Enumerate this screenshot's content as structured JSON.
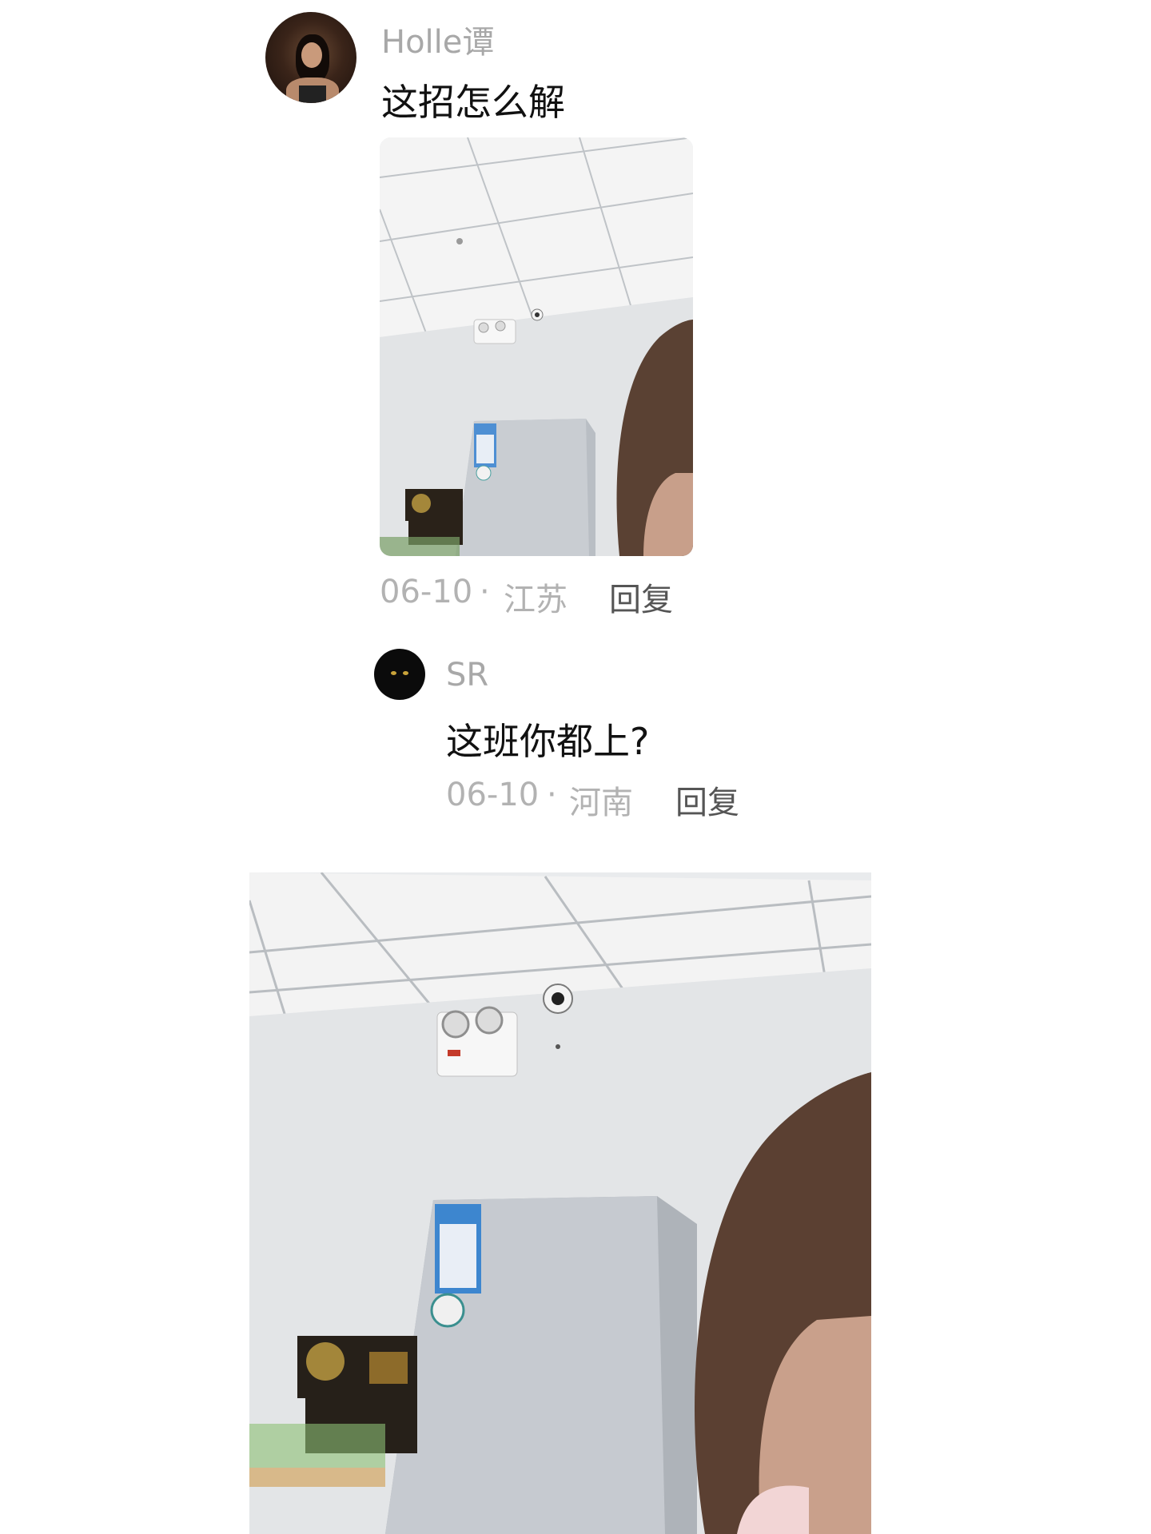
{
  "comment": {
    "username": "Holle谭",
    "text": "这招怎么解",
    "date": "06-10",
    "separator": "·",
    "location": "江苏",
    "reply_label": "回复",
    "avatar_icon": "user-avatar-photo-icon"
  },
  "reply": {
    "username": "SR",
    "text": "这班你都上?",
    "date": "06-10",
    "separator": "·",
    "location": "河南",
    "reply_label": "回复",
    "avatar_icon": "black-cat-avatar-icon"
  },
  "colors": {
    "username": "#a8a8a8",
    "text": "#111111",
    "meta": "#b2b2b2",
    "reply": "#555555",
    "background": "#ffffff"
  }
}
